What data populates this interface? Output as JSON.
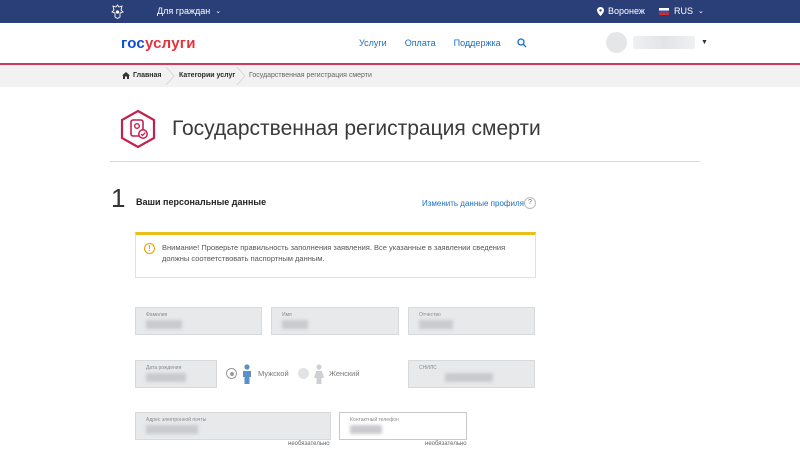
{
  "topbar": {
    "citizens_label": "Для граждан",
    "location": "Воронеж",
    "language": "RUS"
  },
  "header": {
    "logo_part1": "гос",
    "logo_part2": "услуги",
    "nav": [
      "Услуги",
      "Оплата",
      "Поддержка"
    ]
  },
  "breadcrumb": {
    "home": "Главная",
    "categories": "Категории услуг",
    "current": "Государственная регистрация смерти"
  },
  "page": {
    "title": "Государственная регистрация смерти"
  },
  "step": {
    "number": "1",
    "title": "Ваши персональные данные",
    "edit_link": "Изменить данные профиля",
    "help": "?"
  },
  "warning": {
    "text": "Внимание! Проверьте правильность заполнения заявления. Все указанные в заявлении сведения должны соответствовать паспортным данным."
  },
  "fields": {
    "surname_label": "Фамилия",
    "name_label": "Имя",
    "patronymic_label": "Отчество",
    "birthdate_label": "Дата рождения",
    "snils_label": "СНИЛС",
    "email_label": "Адрес электронной почты",
    "phone_label": "Контактный телефон",
    "optional": "необязательно"
  },
  "gender": {
    "male": "Мужской",
    "female": "Женский",
    "selected": "male"
  },
  "colors": {
    "topbar": "#2a3f78",
    "accent_red": "#d23a5c",
    "link": "#1a6fc2",
    "warning_stripe": "#e8c017"
  }
}
